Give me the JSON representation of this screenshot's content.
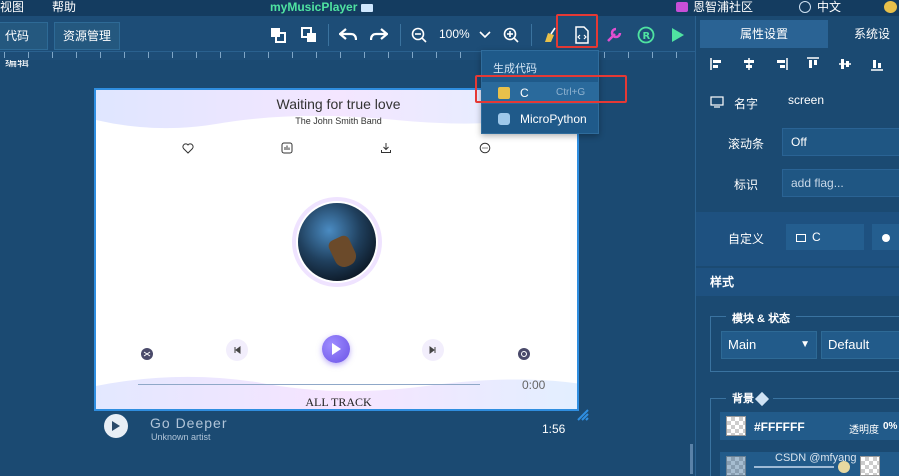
{
  "menubar": {
    "view": "视图",
    "help": "帮助",
    "app_title": "myMusicPlayer",
    "community": "恩智浦社区",
    "language": "中文"
  },
  "toolbar": {
    "tab_code": "代码编辑",
    "tab_resources": "资源管理",
    "zoom": "100%"
  },
  "dropdown": {
    "header": "生成代码",
    "items": [
      {
        "label": "C",
        "shortcut": "Ctrl+G"
      },
      {
        "label": "MicroPython",
        "shortcut": ""
      }
    ]
  },
  "screen": {
    "song_title": "Waiting for true love",
    "band": "The John Smith Band",
    "time": "0:00",
    "all_track": "ALL TRACK"
  },
  "now_playing": {
    "title": "Go Deeper",
    "artist": "Unknown artist",
    "duration": "1:56"
  },
  "right_panel": {
    "tab_props": "属性设置",
    "tab_system": "系统设",
    "name_label": "名字",
    "name_value": "screen",
    "scroll_label": "滚动条",
    "scroll_value": "Off",
    "flag_label": "标识",
    "flag_placeholder": "add flag...",
    "custom_label": "自定义",
    "custom_btn": "C",
    "style_section": "样式",
    "module_state": "模块 & 状态",
    "part_select": "Main",
    "state_select": "Default",
    "bg_label": "背景",
    "bg_color": "#FFFFFF",
    "opacity_label": "透明度",
    "opacity_value": "0%"
  },
  "watermark": "CSDN @mfyang",
  "colors": {
    "background": "#1b4a72",
    "accent_title": "#4fe3a1",
    "highlight": "#e53935",
    "play_button": "#6b53e6"
  }
}
